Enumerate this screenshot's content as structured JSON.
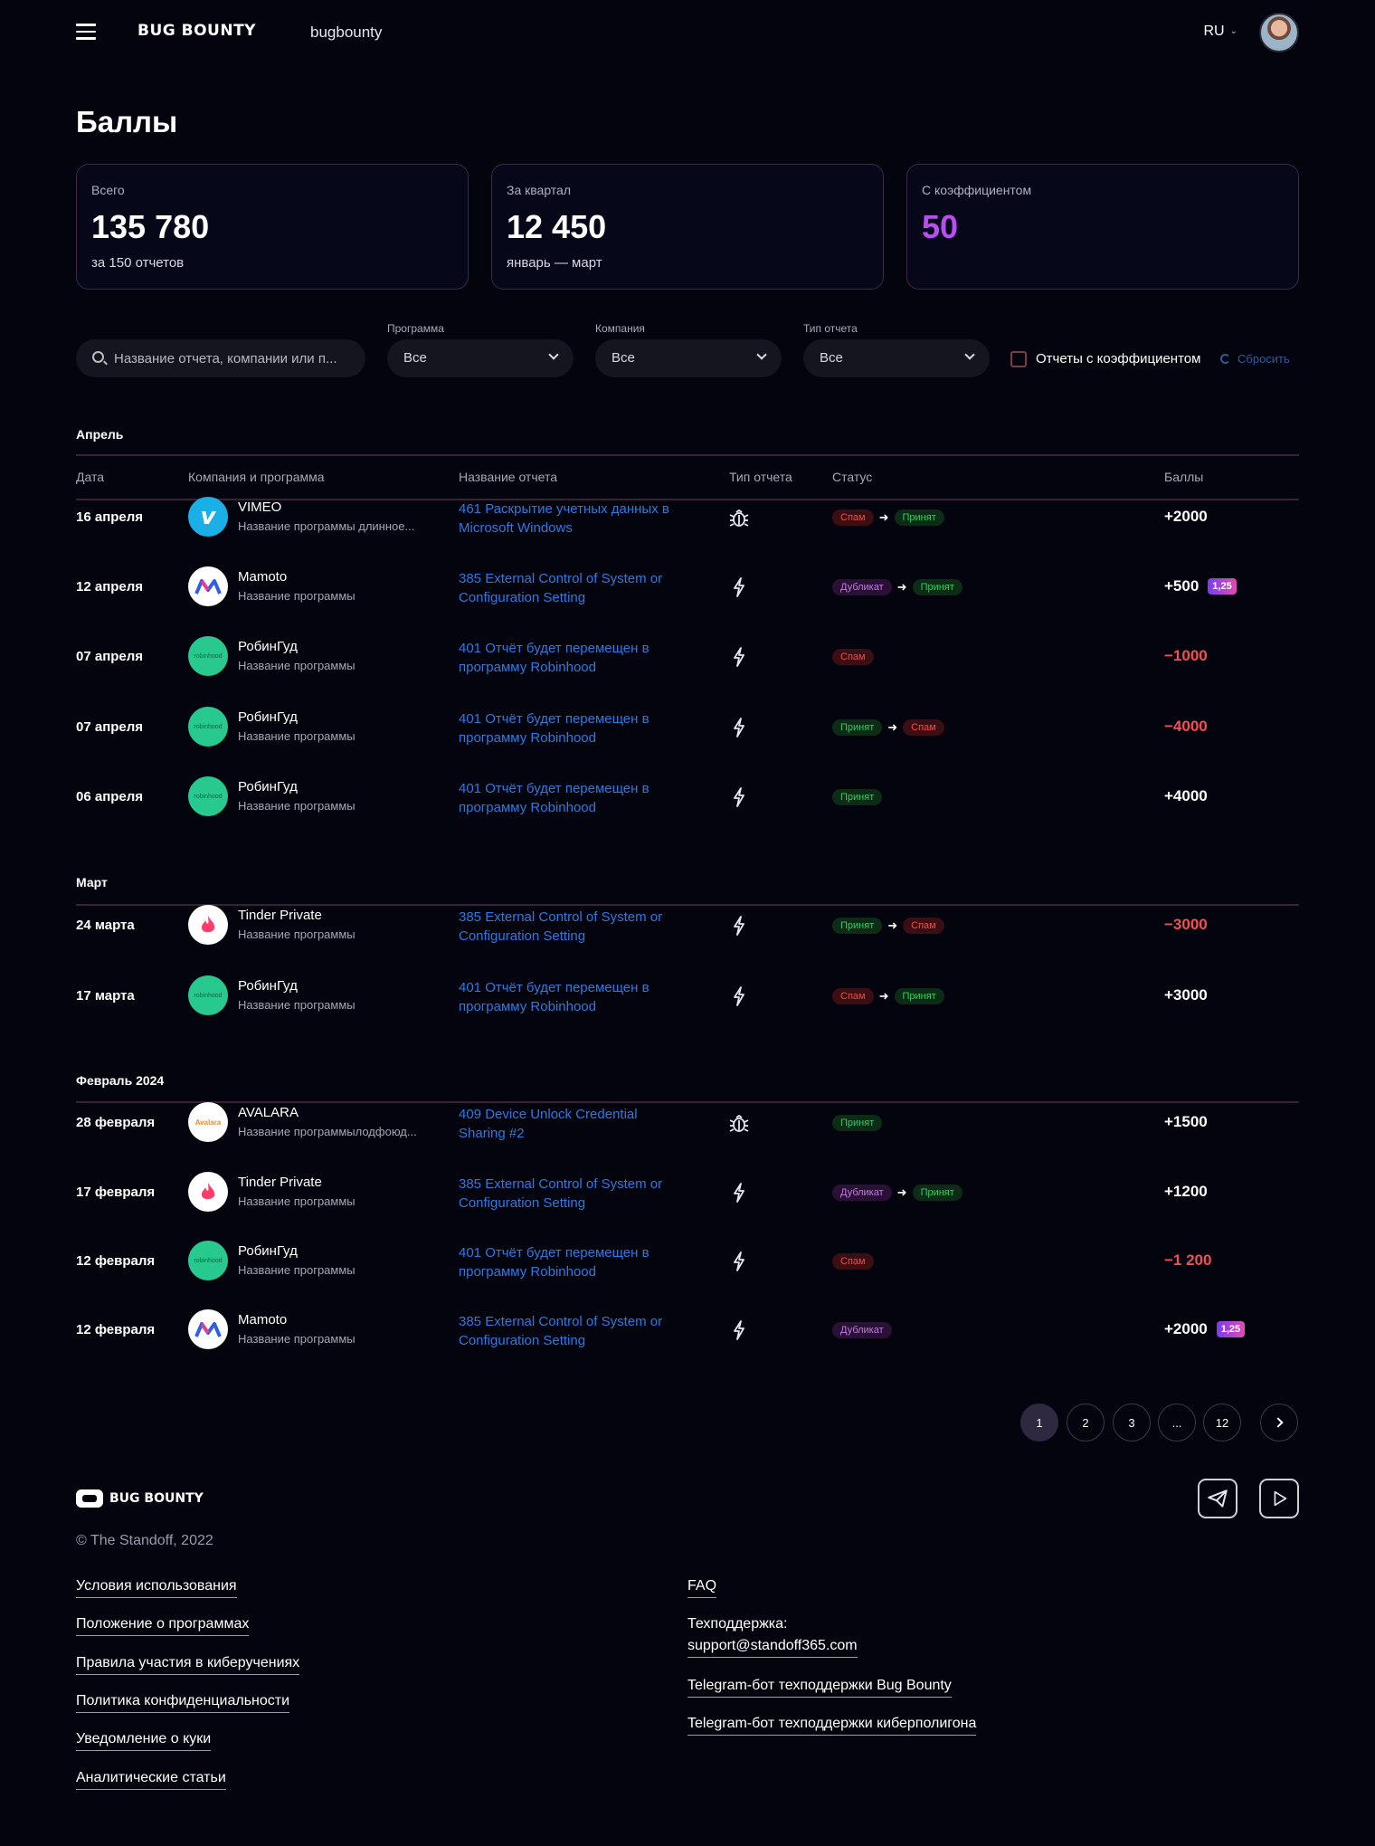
{
  "header": {
    "logo": "BUG BOUNTY",
    "project": "bugbounty",
    "lang": "RU"
  },
  "page_title": "Баллы",
  "cards": [
    {
      "label": "Всего",
      "value": "135 780",
      "sub": "за 150 отчетов"
    },
    {
      "label": "За квартал",
      "value": "12 450",
      "sub": "январь — март"
    },
    {
      "label": "С коэффициентом",
      "value": "50",
      "sub": ""
    }
  ],
  "filters": {
    "search_placeholder": "Название отчета, компании или п...",
    "program_label": "Программа",
    "program_value": "Все",
    "company_label": "Компания",
    "company_value": "Все",
    "type_label": "Тип отчета",
    "type_value": "Все",
    "coef_checkbox_label": "Отчеты с коэффициентом",
    "reset_label": "Сбросить"
  },
  "table_headers": [
    "Дата",
    "Компания и программа",
    "Название отчета",
    "Тип отчета",
    "Статус",
    "Баллы"
  ],
  "groups": [
    {
      "month": "Апрель",
      "rows": [
        {
          "date": "16 апреля",
          "company": "VIMEO",
          "program": "Название программы длинное...",
          "report": "461 Раскрытие учетных данных в Microsoft Windows",
          "type": "bug-icon",
          "status": [
            "Спам",
            "Принят"
          ],
          "points": "+2000",
          "coef": ""
        },
        {
          "date": "12 апреля",
          "company": "Mamoto",
          "program": "Название программы",
          "report": "385 External Control of System or Configuration Setting",
          "type": "lightning-icon",
          "status": [
            "Дубликат",
            "Принят"
          ],
          "points": "+500",
          "coef": "1,25"
        },
        {
          "date": "07 апреля",
          "company": "РобинГуд",
          "program": "Название программы",
          "report": "401 Отчёт будет перемещен в программу Robinhood",
          "type": "lightning-icon",
          "status": [
            "Спам"
          ],
          "points": "−1000",
          "coef": ""
        },
        {
          "date": "07 апреля",
          "company": "РобинГуд",
          "program": "Название программы",
          "report": "401 Отчёт будет перемещен в программу Robinhood",
          "type": "lightning-icon",
          "status": [
            "Принят",
            "Спам"
          ],
          "points": "−4000",
          "coef": ""
        },
        {
          "date": "06 апреля",
          "company": "РобинГуд",
          "program": "Название программы",
          "report": "401 Отчёт будет перемещен в программу Robinhood",
          "type": "lightning-icon",
          "status": [
            "Принят"
          ],
          "points": "+4000",
          "coef": ""
        }
      ]
    },
    {
      "month": "Март",
      "rows": [
        {
          "date": "24 марта",
          "company": "Tinder Private",
          "program": "Название программы",
          "report": "385 External Control of System or Configuration Setting",
          "type": "lightning-icon",
          "status": [
            "Принят",
            "Спам"
          ],
          "points": "−3000",
          "coef": ""
        },
        {
          "date": "17 марта",
          "company": "РобинГуд",
          "program": "Название программы",
          "report": "401 Отчёт будет перемещен в программу Robinhood",
          "type": "lightning-icon",
          "status": [
            "Спам",
            "Принят"
          ],
          "points": "+3000",
          "coef": ""
        }
      ]
    },
    {
      "month": "Февраль 2024",
      "rows": [
        {
          "date": "28 февраля",
          "company": "AVALARA",
          "program": "Название программылодфоюд...",
          "report": "409 Device Unlock Credential Sharing #2",
          "type": "bug-icon",
          "status": [
            "Принят"
          ],
          "points": "+1500",
          "coef": ""
        },
        {
          "date": "17 февраля",
          "company": "Tinder Private",
          "program": "Название программы",
          "report": "385 External Control of System or Configuration Setting",
          "type": "lightning-icon",
          "status": [
            "Дубликат",
            "Принят"
          ],
          "points": "+1200",
          "coef": ""
        },
        {
          "date": "12 февраля",
          "company": "РобинГуд",
          "program": "Название программы",
          "report": "401 Отчёт будет перемещен в программу Robinhood",
          "type": "lightning-icon",
          "status": [
            "Спам"
          ],
          "points": "−1 200",
          "coef": ""
        },
        {
          "date": "12 февраля",
          "company": "Mamoto",
          "program": "Название программы",
          "report": "385 External Control of System or Configuration Setting",
          "type": "lightning-icon",
          "status": [
            "Дубликат"
          ],
          "points": "+2000",
          "coef": "1,25"
        }
      ]
    }
  ],
  "pagination": {
    "pages": [
      "1",
      "2",
      "3",
      "...",
      "12"
    ],
    "current": "1"
  },
  "footer": {
    "logo": "BUG BOUNTY",
    "copyright": "© The Standoff, 2022",
    "links_left": [
      "Условия использования",
      "Положение о программах",
      "Правила участия в киберучениях",
      "Политика конфиденциальности",
      "Уведомление о куки",
      "Аналитические статьи"
    ],
    "faq": "FAQ",
    "support_label": "Техподдержка:",
    "support_email": "support@standoff365.com",
    "links_right": [
      "Telegram-бот техподдержки Bug Bounty",
      "Telegram-бот техподдержки киберполигона"
    ]
  }
}
